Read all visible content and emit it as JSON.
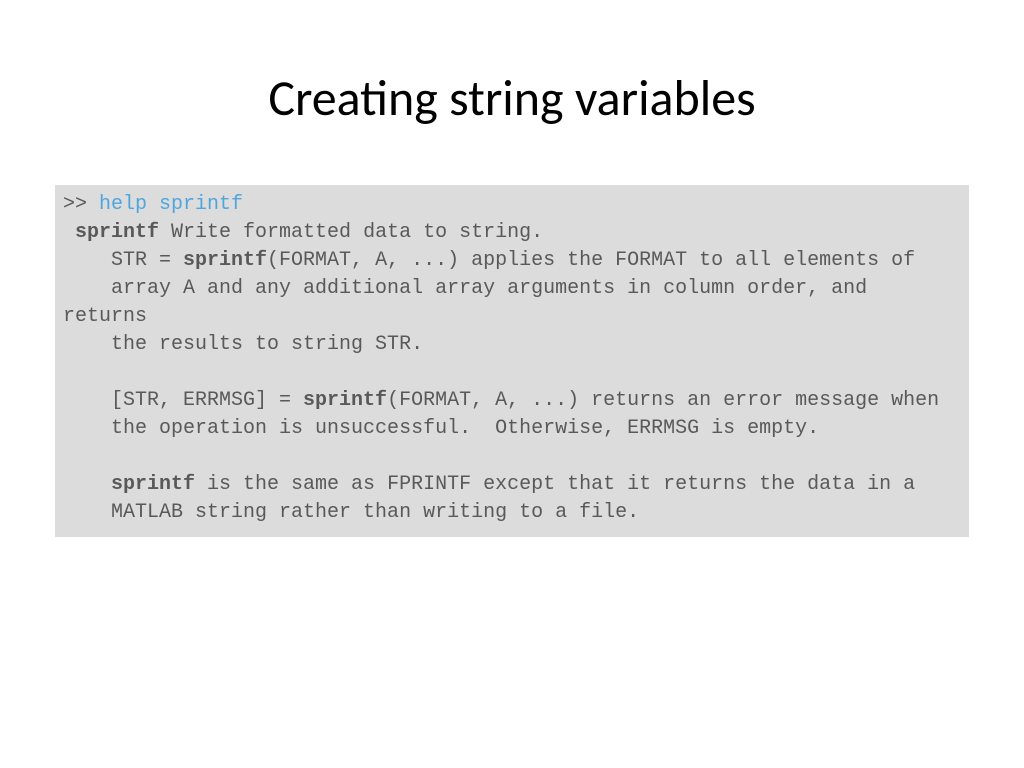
{
  "title": "Creating string variables",
  "code": {
    "prompt": ">> ",
    "command": "help sprintf",
    "line2_pre": " ",
    "line2_bold": "sprintf",
    "line2_post": " Write formatted data to string.",
    "line3_pre": "    STR = ",
    "line3_bold": "sprintf",
    "line3_post": "(FORMAT, A, ...) applies the FORMAT to all elements of",
    "line4": "    array A and any additional array arguments in column order, and returns",
    "line5": "    the results to string STR.",
    "blank1": " ",
    "line6_pre": "    [STR, ERRMSG] = ",
    "line6_bold": "sprintf",
    "line6_post": "(FORMAT, A, ...) returns an error message when",
    "line7": "    the operation is unsuccessful.  Otherwise, ERRMSG is empty.",
    "blank2": " ",
    "line8_pre": "    ",
    "line8_bold": "sprintf",
    "line8_post": " is the same as FPRINTF except that it returns the data in a",
    "line9": "    MATLAB string rather than writing to a file."
  }
}
